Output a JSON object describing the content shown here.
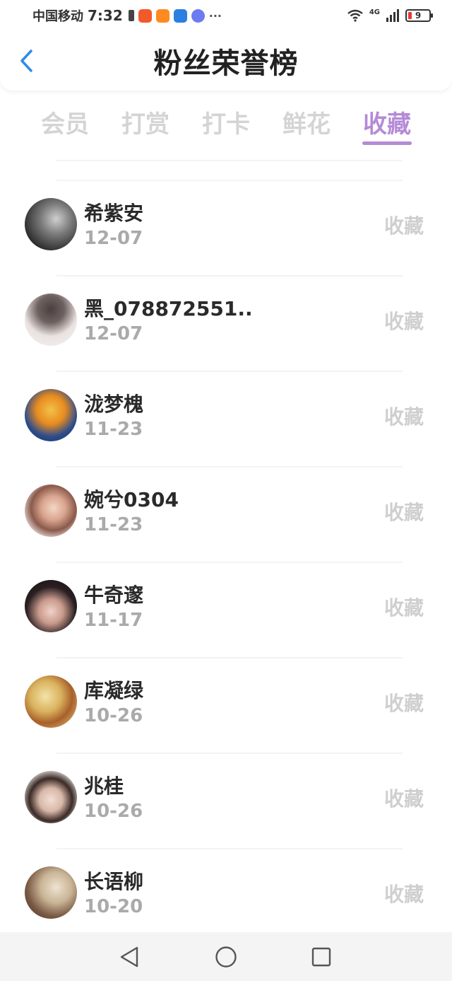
{
  "status_bar": {
    "carrier": "中国移动",
    "time": "7:32",
    "network": "4G",
    "battery": "9",
    "more": "···"
  },
  "header": {
    "title": "粉丝荣誉榜"
  },
  "tabs": [
    {
      "label": "会员"
    },
    {
      "label": "打赏"
    },
    {
      "label": "打卡"
    },
    {
      "label": "鲜花"
    },
    {
      "label": "收藏"
    }
  ],
  "active_tab": "收藏",
  "list": [
    {
      "name": "希紫安",
      "date": "12-07",
      "action": "收藏"
    },
    {
      "name": "黑_078872551...",
      "date": "12-07",
      "action": "收藏"
    },
    {
      "name": "泷梦槐",
      "date": "11-23",
      "action": "收藏"
    },
    {
      "name": "婉兮0304",
      "date": "11-23",
      "action": "收藏"
    },
    {
      "name": "牛奇邃",
      "date": "11-17",
      "action": "收藏"
    },
    {
      "name": "库凝绿",
      "date": "10-26",
      "action": "收藏"
    },
    {
      "name": "兆桂",
      "date": "10-26",
      "action": "收藏"
    },
    {
      "name": "长语柳",
      "date": "10-20",
      "action": "收藏"
    }
  ],
  "colors": {
    "accent": "#b58ad6",
    "back_icon": "#2e8be6",
    "tab_inactive": "#d4d4d4",
    "date": "#aaaaaa",
    "action": "#cfcfcf"
  },
  "icons": {
    "back": "chevron-left-icon",
    "nav_back": "triangle-back-icon",
    "nav_home": "circle-home-icon",
    "nav_recents": "square-recents-icon"
  }
}
